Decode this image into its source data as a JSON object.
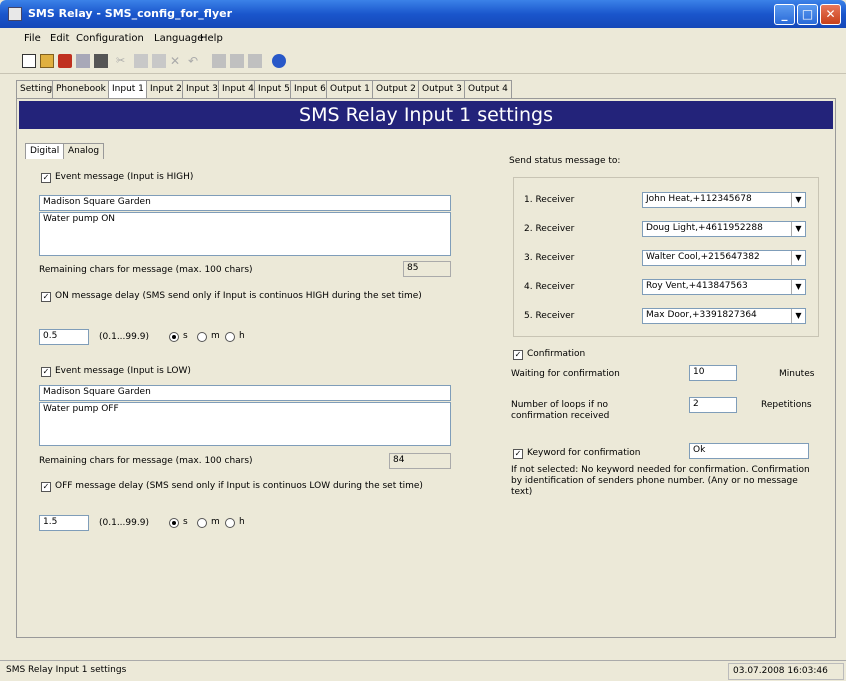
{
  "window": {
    "title": "SMS Relay - SMS_config_for_flyer"
  },
  "menu": [
    "File",
    "Edit",
    "Configuration",
    "Language",
    "Help"
  ],
  "tabs": [
    "Settings",
    "Phonebook",
    "Input 1",
    "Input 2",
    "Input 3",
    "Input 4",
    "Input 5",
    "Input 6",
    "Output 1",
    "Output 2",
    "Output 3",
    "Output 4"
  ],
  "active_tab": "Input 1",
  "banner": "SMS Relay Input 1 settings",
  "sub_tabs": [
    "Digital",
    "Analog"
  ],
  "high": {
    "checkbox_label": "Event message (Input is HIGH)",
    "line1": "Madison Square Garden",
    "line2": "Water pump ON",
    "remaining_label": "Remaining chars for message  (max. 100 chars)",
    "remaining_value": "85",
    "delay_label": "ON message delay (SMS send only if Input is continuos HIGH during the set time)",
    "delay_value": "0.5",
    "range": "(0.1...99.9)",
    "units": [
      "s",
      "m",
      "h"
    ],
    "selected_unit": "s"
  },
  "low": {
    "checkbox_label": "Event message (Input is LOW)",
    "line1": "Madison Square Garden",
    "line2": "Water pump OFF",
    "remaining_label": "Remaining chars for message  (max. 100 chars)",
    "remaining_value": "84",
    "delay_label": "OFF message delay (SMS send only if Input is continuos  LOW during the set time)",
    "delay_value": "1.5",
    "range": "(0.1...99.9)",
    "units": [
      "s",
      "m",
      "h"
    ],
    "selected_unit": "s"
  },
  "receivers": {
    "title": "Send status message to:",
    "items": [
      {
        "label": "1. Receiver",
        "value": "John Heat,+112345678"
      },
      {
        "label": "2. Receiver",
        "value": "Doug Light,+4611952288"
      },
      {
        "label": "3. Receiver",
        "value": "Walter Cool,+215647382"
      },
      {
        "label": "4. Receiver",
        "value": "Roy Vent,+413847563"
      },
      {
        "label": "5. Receiver",
        "value": "Max Door,+3391827364"
      }
    ]
  },
  "confirmation": {
    "checkbox_label": "Confirmation",
    "waiting_label": "Waiting for confirmation",
    "waiting_value": "10",
    "waiting_unit": "Minutes",
    "loops_label": "Number of loops if no confirmation received",
    "loops_value": "2",
    "loops_unit": "Repetitions",
    "keyword_label": "Keyword for confirmation",
    "keyword_value": "Ok",
    "note": "If not selected: No keyword needed for confirmation.  Confirmation by identification of senders phone number. (Any or no message text)"
  },
  "status": {
    "left": "SMS Relay Input 1 settings",
    "right": "03.07.2008 16:03:46"
  }
}
